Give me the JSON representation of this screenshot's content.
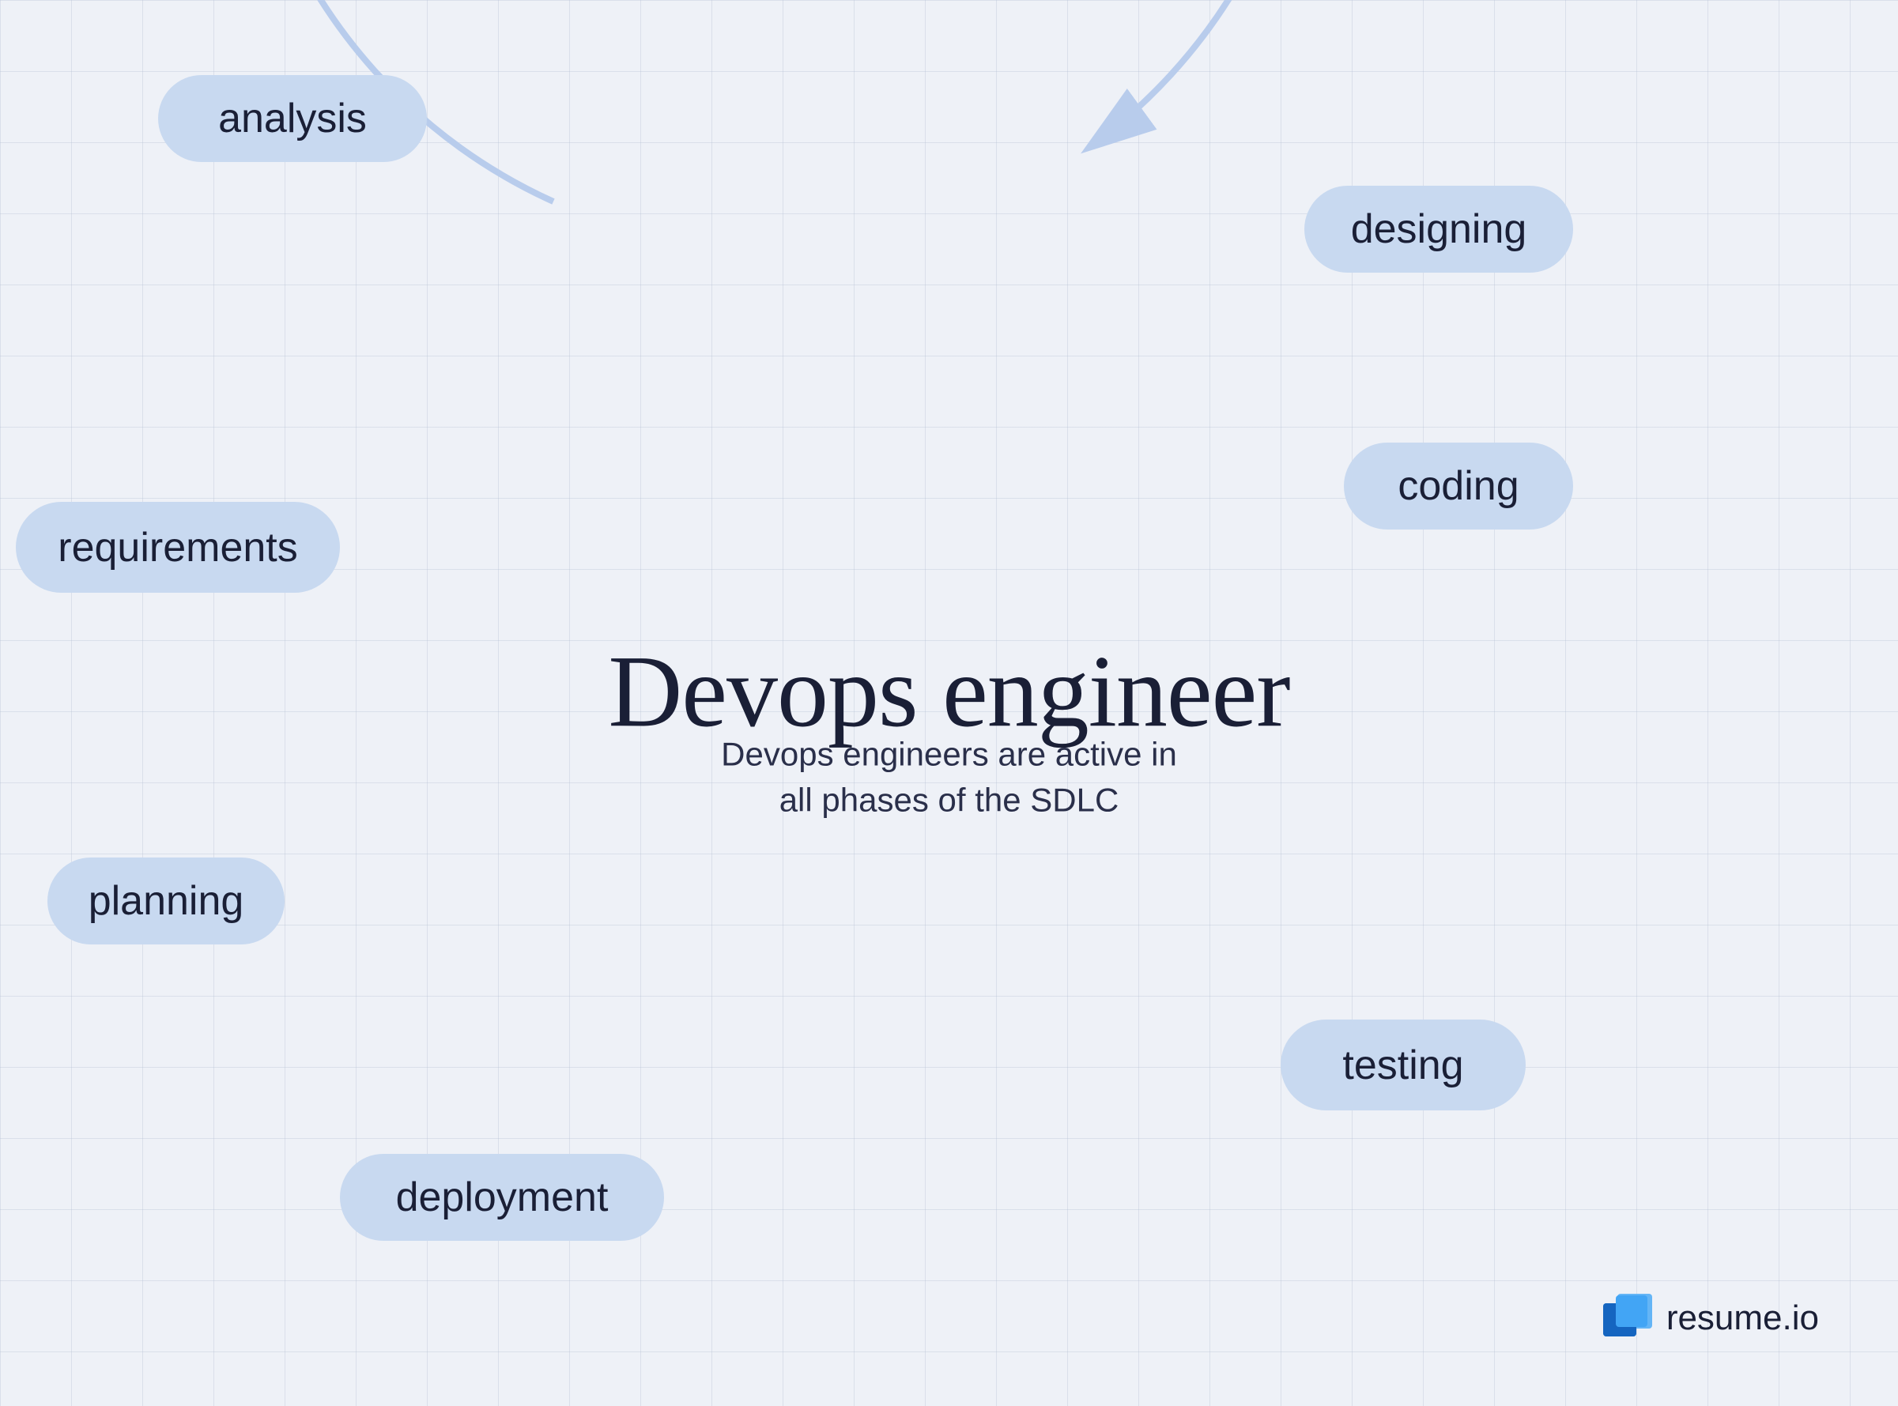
{
  "title": "Devops engineer",
  "subtitle": "Devops engineers are active in all phases of the SDLC",
  "phases": [
    {
      "id": "analysis",
      "label": "analysis"
    },
    {
      "id": "designing",
      "label": "designing"
    },
    {
      "id": "coding",
      "label": "coding"
    },
    {
      "id": "testing",
      "label": "testing"
    },
    {
      "id": "deployment",
      "label": "deployment"
    },
    {
      "id": "planning",
      "label": "planning"
    },
    {
      "id": "requirements",
      "label": "requirements"
    }
  ],
  "logo": {
    "name": "resume.io",
    "text": "resume.io"
  },
  "colors": {
    "pill_bg": "#c8d9f0",
    "circle_stroke": "#b8ccec",
    "text_dark": "#1a1f36",
    "bg": "#eef1f7"
  }
}
